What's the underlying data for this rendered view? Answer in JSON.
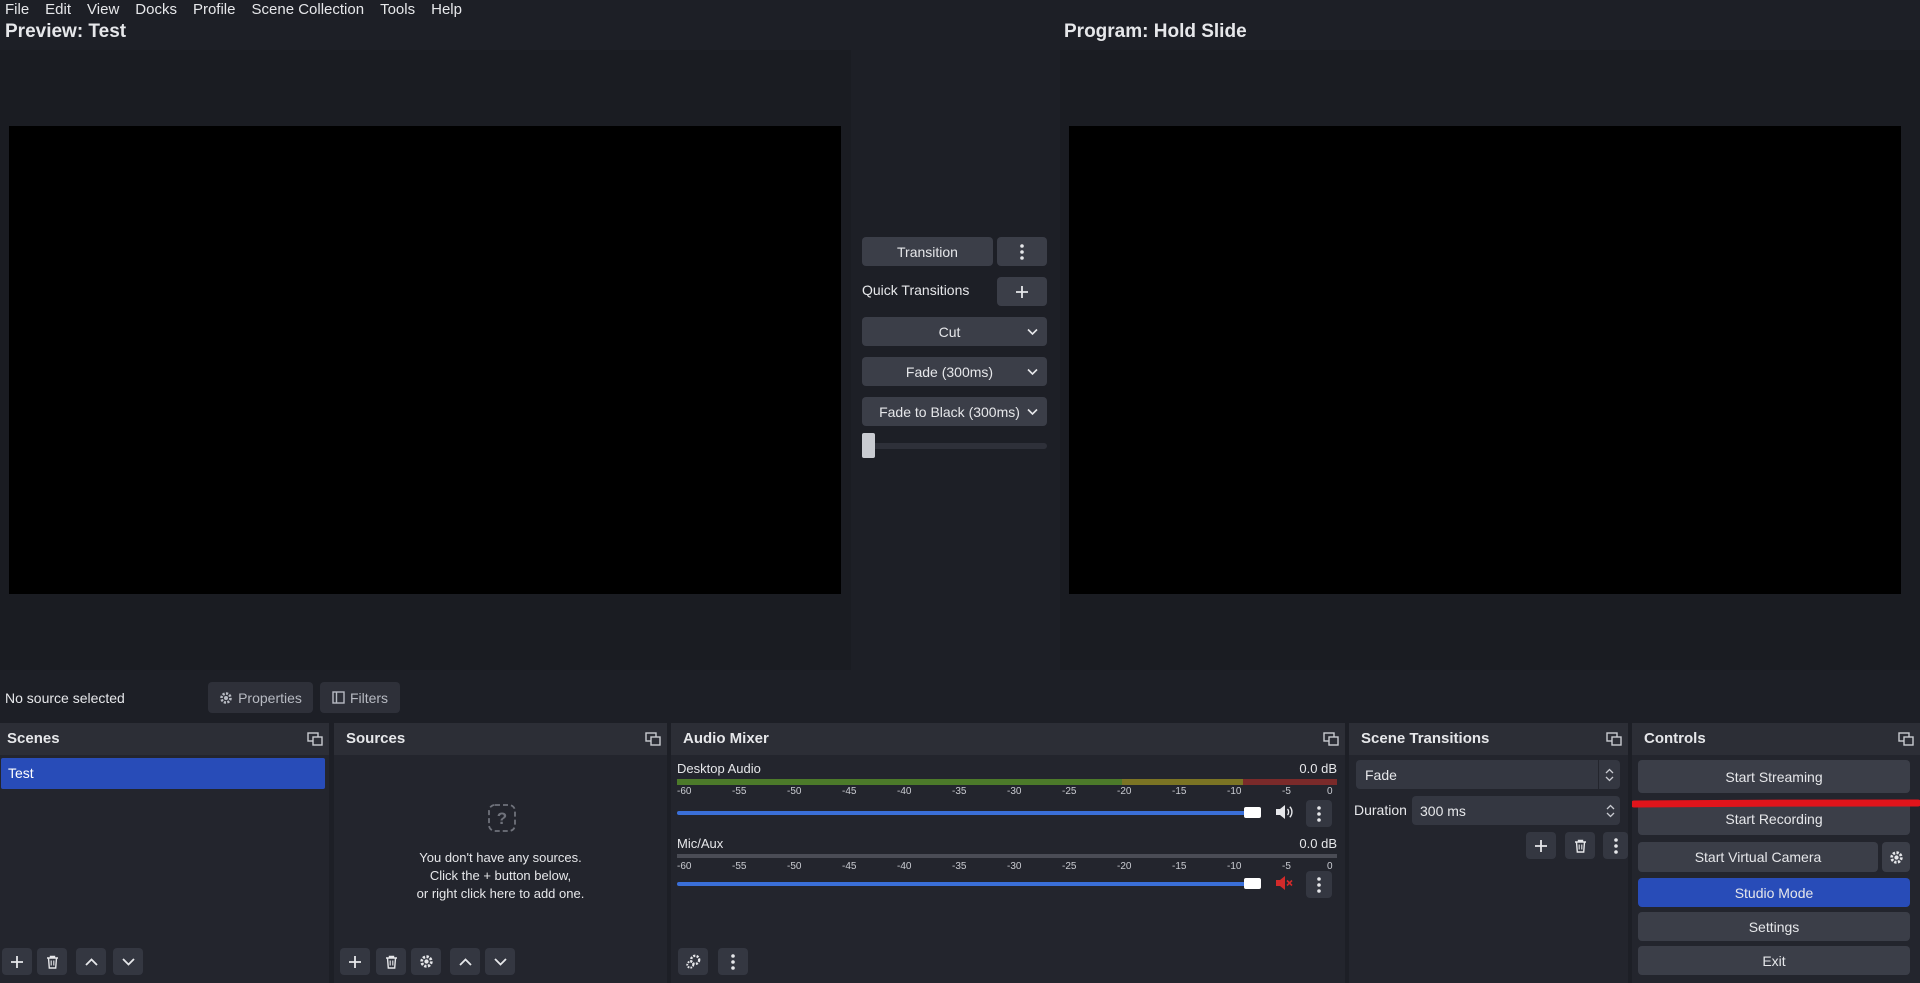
{
  "menubar": [
    "File",
    "Edit",
    "View",
    "Docks",
    "Profile",
    "Scene Collection",
    "Tools",
    "Help"
  ],
  "preview": {
    "title": "Preview: Test"
  },
  "program": {
    "title": "Program: Hold Slide"
  },
  "studio": {
    "transition_button": "Transition",
    "quick_transitions_label": "Quick Transitions",
    "quick_transitions": [
      "Cut",
      "Fade (300ms)",
      "Fade to Black (300ms)"
    ],
    "tbar_position": 0
  },
  "source_bar": {
    "status": "No source selected",
    "properties": "Properties",
    "filters": "Filters"
  },
  "scenes": {
    "title": "Scenes",
    "items": [
      "Test"
    ],
    "selected": "Test"
  },
  "sources": {
    "title": "Sources",
    "empty_line1": "You don't have any sources.",
    "empty_line2": "Click the + button below,",
    "empty_line3": "or right click here to add one."
  },
  "mixer": {
    "title": "Audio Mixer",
    "scale": [
      "-60",
      "-55",
      "-50",
      "-45",
      "-40",
      "-35",
      "-30",
      "-25",
      "-20",
      "-15",
      "-10",
      "-5",
      "0"
    ],
    "channels": [
      {
        "name": "Desktop Audio",
        "level": "0.0 dB",
        "volume": 1.0,
        "muted": false
      },
      {
        "name": "Mic/Aux",
        "level": "0.0 dB",
        "volume": 1.0,
        "muted": true
      }
    ]
  },
  "transitions": {
    "title": "Scene Transitions",
    "selected": "Fade",
    "duration_label": "Duration",
    "duration_value": "300 ms"
  },
  "controls": {
    "title": "Controls",
    "start_streaming": "Start Streaming",
    "start_recording": "Start Recording",
    "start_virtual_camera": "Start Virtual Camera",
    "studio_mode": "Studio Mode",
    "settings": "Settings",
    "exit": "Exit"
  },
  "colors": {
    "accent": "#284cb8",
    "mute_red": "#d22a2a",
    "annotation_red": "#e0141b",
    "meter_green": "#4c7a2a",
    "meter_yellow": "#7b7424",
    "meter_red": "#7a2a2a"
  },
  "icons": [
    "gear-icon",
    "filters-icon",
    "help-icon",
    "plus-icon",
    "trash-icon",
    "chevron-up-icon",
    "chevron-down-icon",
    "more-vertical-icon",
    "float-dock-icon",
    "speaker-icon",
    "speaker-muted-icon",
    "advanced-audio-icon",
    "spinbox-arrows-icon"
  ]
}
